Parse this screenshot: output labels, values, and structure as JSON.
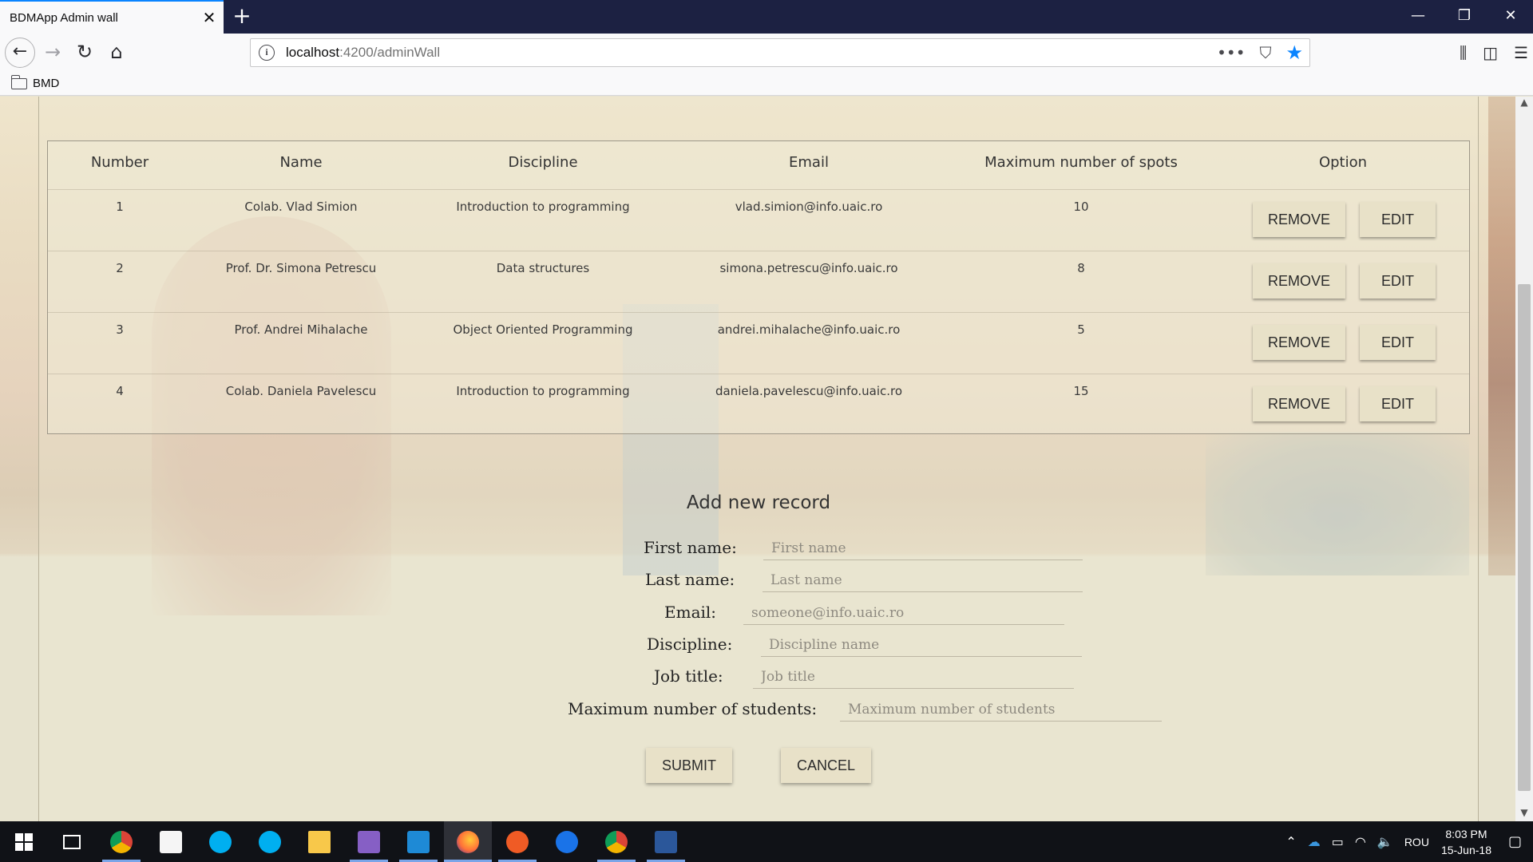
{
  "browser": {
    "tab_title": "BDMApp Admin wall",
    "url_host": "localhost",
    "url_path": ":4200/adminWall",
    "bookmark_folder": "BMD"
  },
  "table": {
    "headers": [
      "Number",
      "Name",
      "Discipline",
      "Email",
      "Maximum number of spots",
      "Option"
    ],
    "rows": [
      {
        "number": "1",
        "name": "Colab. Vlad Simion",
        "discipline": "Introduction to programming",
        "email": "vlad.simion@info.uaic.ro",
        "spots": "10"
      },
      {
        "number": "2",
        "name": "Prof. Dr. Simona Petrescu",
        "discipline": "Data structures",
        "email": "simona.petrescu@info.uaic.ro",
        "spots": "8"
      },
      {
        "number": "3",
        "name": "Prof. Andrei Mihalache",
        "discipline": "Object Oriented Programming",
        "email": "andrei.mihalache@info.uaic.ro",
        "spots": "5"
      },
      {
        "number": "4",
        "name": "Colab. Daniela Pavelescu",
        "discipline": "Introduction to programming",
        "email": "daniela.pavelescu@info.uaic.ro",
        "spots": "15"
      }
    ],
    "remove_label": "REMOVE",
    "edit_label": "EDIT"
  },
  "form": {
    "title": "Add new record",
    "fields": [
      {
        "label": "First name:",
        "placeholder": "First name"
      },
      {
        "label": "Last name:",
        "placeholder": "Last name"
      },
      {
        "label": "Email:",
        "placeholder": "someone@info.uaic.ro"
      },
      {
        "label": "Discipline:",
        "placeholder": "Discipline name"
      },
      {
        "label": "Job title:",
        "placeholder": "Job title"
      },
      {
        "label": "Maximum number of students:",
        "placeholder": "Maximum number of students"
      }
    ],
    "submit_label": "SUBMIT",
    "cancel_label": "CANCEL"
  },
  "taskbar": {
    "language": "ROU",
    "time": "8:03 PM",
    "date": "15-Jun-18",
    "apps": [
      "chrome",
      "store",
      "skype",
      "skype",
      "file-explorer",
      "visual-studio",
      "vs-code",
      "firefox",
      "postman",
      "maps",
      "chrome",
      "word"
    ]
  },
  "colors": {
    "accent": "#0a84ff",
    "titlebar": "#1c2142",
    "button_bg": "#e8e1c8",
    "taskbar": "#101217"
  }
}
